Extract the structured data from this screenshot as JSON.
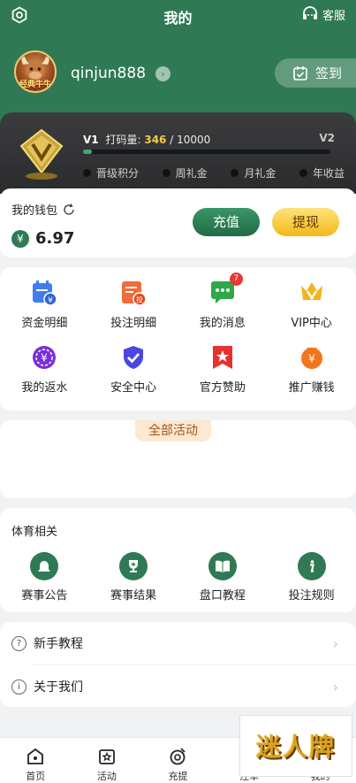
{
  "header": {
    "title": "我的",
    "service_label": "客服"
  },
  "profile": {
    "username": "qinjun888",
    "avatar_text": "经典牛牛",
    "checkin_label": "签到"
  },
  "vip": {
    "level": "V1",
    "bet_label": "打码量:",
    "bet_current": "346",
    "bet_separator": "/",
    "bet_target": "10000",
    "next_level": "V2",
    "progress_fraction": 0.0346,
    "perks": [
      "晋级积分",
      "周礼金",
      "月礼金",
      "年收益"
    ]
  },
  "wallet": {
    "title": "我的钱包",
    "currency_symbol": "¥",
    "balance": "6.97",
    "deposit_label": "充值",
    "withdraw_label": "提现"
  },
  "menu": {
    "items": [
      {
        "label": "资金明细",
        "icon": "fund-detail-icon"
      },
      {
        "label": "投注明细",
        "icon": "bet-detail-icon"
      },
      {
        "label": "我的消息",
        "icon": "message-icon",
        "badge": "7"
      },
      {
        "label": "VIP中心",
        "icon": "vip-crown-icon"
      },
      {
        "label": "我的返水",
        "icon": "rebate-icon"
      },
      {
        "label": "安全中心",
        "icon": "shield-icon"
      },
      {
        "label": "官方赞助",
        "icon": "sponsor-icon"
      },
      {
        "label": "推广赚钱",
        "icon": "promote-icon"
      }
    ],
    "bet_icon_text": "投"
  },
  "activities": {
    "tab_label": "全部活动"
  },
  "sports": {
    "title": "体育相关",
    "items": [
      {
        "label": "赛事公告",
        "icon": "bell-icon"
      },
      {
        "label": "赛事结果",
        "icon": "trophy-icon"
      },
      {
        "label": "盘口教程",
        "icon": "book-icon"
      },
      {
        "label": "投注规则",
        "icon": "info-icon"
      }
    ]
  },
  "links": {
    "items": [
      {
        "label": "新手教程",
        "icon": "question-icon",
        "glyph": "?"
      },
      {
        "label": "关于我们",
        "icon": "info-outline-icon",
        "glyph": "i"
      }
    ]
  },
  "tabbar": {
    "items": [
      {
        "label": "首页",
        "icon": "home-icon"
      },
      {
        "label": "活动",
        "icon": "activity-icon"
      },
      {
        "label": "充提",
        "icon": "deposit-withdraw-icon"
      },
      {
        "label": "注单",
        "icon": "bet-slip-icon"
      },
      {
        "label": "我的",
        "icon": "profile-icon"
      }
    ]
  },
  "watermark": {
    "text": "迷人牌"
  },
  "colors": {
    "primary": "#2f7a55",
    "gold": "#f2b81a",
    "vip_dark": "#2a2b2d",
    "badge_red": "#e53935"
  }
}
